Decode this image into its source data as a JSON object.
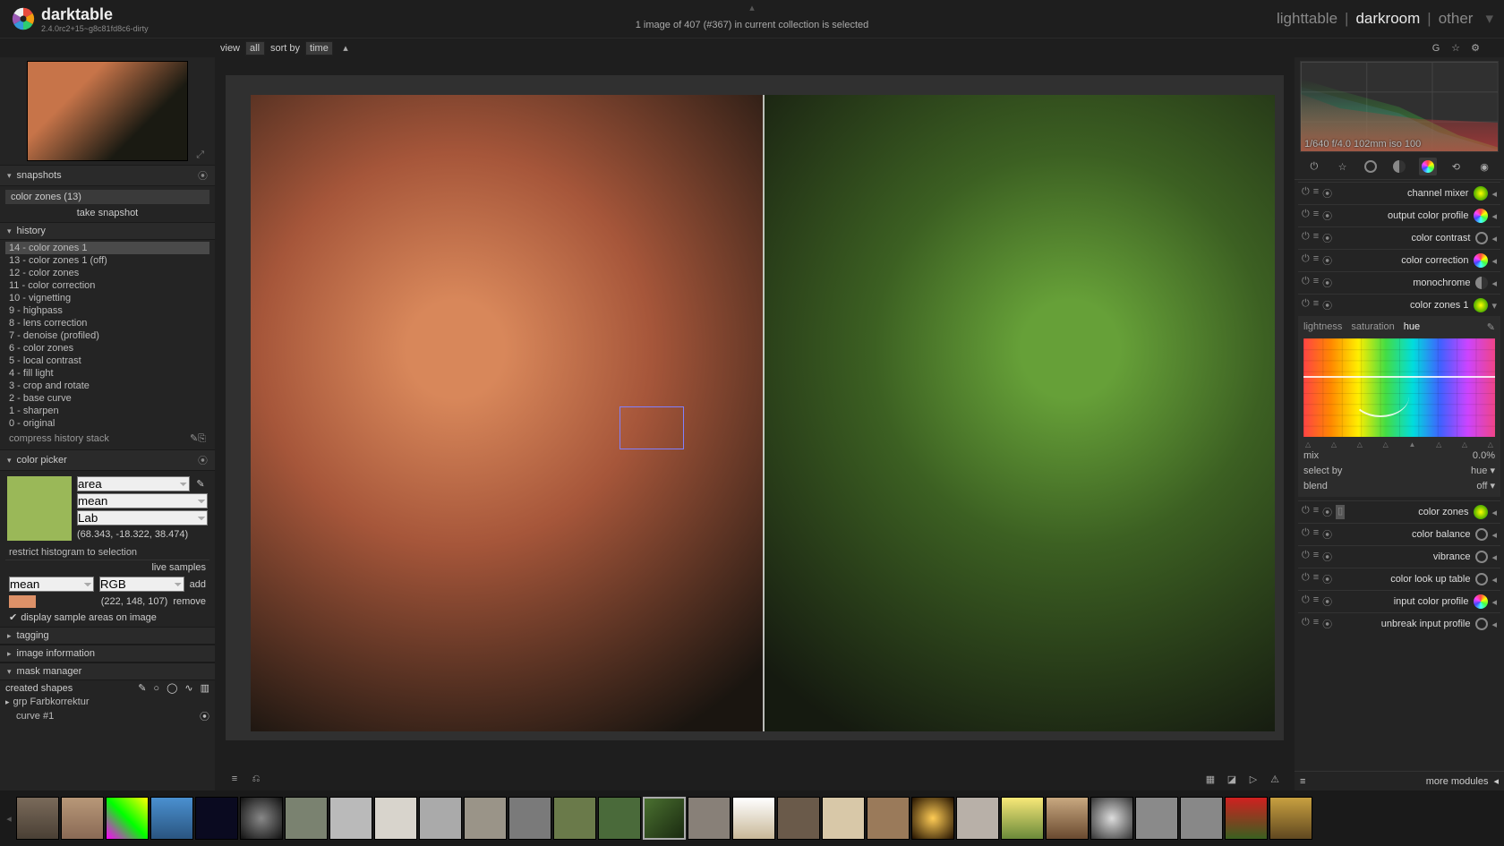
{
  "app": {
    "title": "darktable",
    "version": "2.4.0rc2+15~g8c81fd8c6-dirty",
    "status_line": "1 image of 407 (#367) in current collection is selected"
  },
  "views": {
    "lighttable": "lighttable",
    "darkroom": "darkroom",
    "other": "other",
    "active": "darkroom"
  },
  "toolbar": {
    "view_label": "view",
    "view_value": "all",
    "sort_label": "sort by",
    "sort_value": "time"
  },
  "left": {
    "snapshots": {
      "title": "snapshots",
      "items": [
        "color zones (13)"
      ],
      "take": "take snapshot"
    },
    "history": {
      "title": "history",
      "items": [
        "14 - color zones 1",
        "13 - color zones 1 (off)",
        "12 - color zones",
        "11 - color correction",
        "10 - vignetting",
        "9 - highpass",
        "8 - lens correction",
        "7 - denoise (profiled)",
        "6 - color zones",
        "5 - local contrast",
        "4 - fill light",
        "3 - crop and rotate",
        "2 - base curve",
        "1 - sharpen",
        "0 - original"
      ],
      "compress": "compress history stack"
    },
    "color_picker": {
      "title": "color picker",
      "mode": "area",
      "stat": "mean",
      "space": "Lab",
      "lab_value": "(68.343, -18.322, 38.474)",
      "restrict": "restrict histogram to selection",
      "live": "live samples",
      "row_stat": "mean",
      "row_space": "RGB",
      "add": "add",
      "rgb_value": "(222, 148, 107)",
      "remove": "remove",
      "display_checkbox": "display sample areas on image"
    },
    "tagging": {
      "title": "tagging"
    },
    "image_info": {
      "title": "image information"
    },
    "mask_manager": {
      "title": "mask manager",
      "shapes": "created shapes",
      "group": "grp Farbkorrektur",
      "curve": "curve #1"
    }
  },
  "right": {
    "exif": "1/640 f/4.0 102mm iso 100",
    "modules": [
      {
        "label": "channel mixer",
        "icon": "gradient"
      },
      {
        "label": "output color profile",
        "icon": "rainbow"
      },
      {
        "label": "color contrast",
        "icon": "circle"
      },
      {
        "label": "color correction",
        "icon": "rainbow"
      },
      {
        "label": "monochrome",
        "icon": "half"
      },
      {
        "label": "color zones 1",
        "icon": "gradient",
        "expanded": true
      }
    ],
    "color_zones": {
      "tabs": [
        "lightness",
        "saturation",
        "hue"
      ],
      "active_tab": "hue",
      "mix_label": "mix",
      "mix_value": "0.0%",
      "select_label": "select by",
      "select_value": "hue",
      "blend_label": "blend",
      "blend_value": "off"
    },
    "modules2": [
      {
        "label": "color zones",
        "icon": "gradient"
      },
      {
        "label": "color balance",
        "icon": "circle"
      },
      {
        "label": "vibrance",
        "icon": "circle"
      },
      {
        "label": "color look up table",
        "icon": "circle"
      },
      {
        "label": "input color profile",
        "icon": "rainbow"
      },
      {
        "label": "unbreak input profile",
        "icon": "circle"
      }
    ],
    "more_modules": "more modules"
  }
}
